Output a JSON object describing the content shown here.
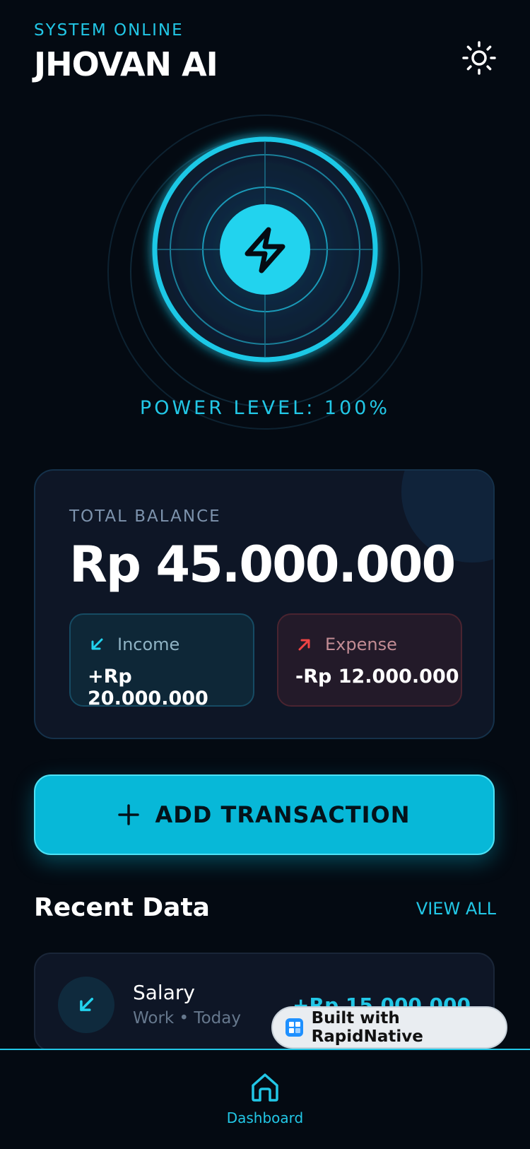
{
  "header": {
    "status": "SYSTEM ONLINE",
    "title": "JHOVAN AI",
    "theme_icon": "sun-icon"
  },
  "reactor": {
    "icon": "lightning-bolt-icon",
    "power_label": "POWER LEVEL: 100%",
    "power_level": 100
  },
  "balance": {
    "label": "TOTAL BALANCE",
    "value": "Rp 45.000.000",
    "income": {
      "label": "Income",
      "value": "+Rp 20.000.000",
      "icon": "arrow-down-left-icon"
    },
    "expense": {
      "label": "Expense",
      "value": "-Rp 12.000.000",
      "icon": "arrow-up-right-icon"
    }
  },
  "actions": {
    "add_label": "ADD TRANSACTION",
    "add_icon": "plus-icon"
  },
  "recent": {
    "title": "Recent Data",
    "view_all": "VIEW ALL",
    "items": [
      {
        "name": "Salary",
        "meta": "Work • Today",
        "amount": "+Rp 15.000.000",
        "icon": "arrow-down-left-icon"
      }
    ]
  },
  "badge": {
    "label": "Built with RapidNative"
  },
  "nav": {
    "items": [
      {
        "label": "Dashboard",
        "icon": "home-icon"
      }
    ]
  },
  "colors": {
    "accent": "#22c7e6",
    "background": "#040a12",
    "income": "#22c7e6",
    "expense": "#ef4444"
  }
}
